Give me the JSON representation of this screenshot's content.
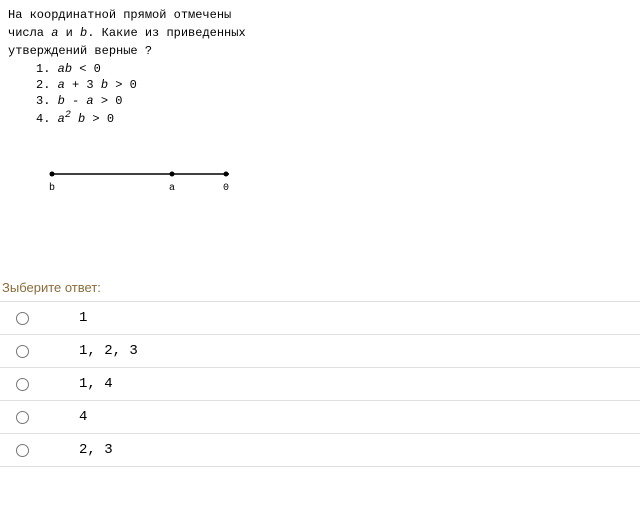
{
  "question": {
    "para1_pre": "На координатной прямой отмечены",
    "para2_pre": "числа ",
    "a": "a",
    "para2_mid": " и ",
    "b": "b",
    "para2_post": ". Какие из приведенных",
    "para3": "утверждений верные ?"
  },
  "statements": {
    "s1_num": "1. ",
    "s1_a": "a",
    "s1_b": "b",
    "s1_rest": " < 0",
    "s2_num": "2. ",
    "s2_a": "a",
    "s2_mid": " + 3 ",
    "s2_b": "b",
    "s2_rest": " > 0",
    "s3_num": "3. ",
    "s3_b": "b",
    "s3_mid": " - ",
    "s3_a": "a",
    "s3_rest": " > 0",
    "s4_num": "4. ",
    "s4_a": "a",
    "s4_sup": "2",
    "s4_sp": " ",
    "s4_b": "b",
    "s4_rest": " > 0"
  },
  "diagram": {
    "label_b": "b",
    "label_a": "a",
    "label_0": "0"
  },
  "prompt": "Зыберите ответ:",
  "options": [
    "1",
    "1, 2, 3",
    "1, 4",
    "4",
    "2, 3"
  ]
}
